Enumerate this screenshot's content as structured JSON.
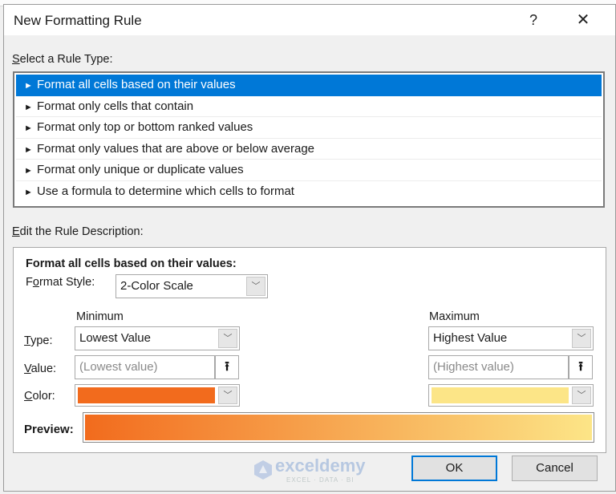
{
  "window": {
    "title": "New Formatting Rule",
    "help_label": "?",
    "close_label": "✕"
  },
  "rule_type": {
    "label_underline": "S",
    "label_rest": "elect a Rule Type:",
    "arrow_glyph": "►",
    "items": [
      {
        "label": "Format all cells based on their values",
        "selected": true
      },
      {
        "label": "Format only cells that contain",
        "selected": false
      },
      {
        "label": "Format only top or bottom ranked values",
        "selected": false
      },
      {
        "label": "Format only values that are above or below average",
        "selected": false
      },
      {
        "label": "Format only unique or duplicate values",
        "selected": false
      },
      {
        "label": "Use a formula to determine which cells to format",
        "selected": false
      }
    ]
  },
  "description": {
    "label_underline": "E",
    "label_rest": "dit the Rule Description:",
    "heading": "Format all cells based on their values:",
    "format_style": {
      "label_pre": "F",
      "label_underline": "o",
      "label_rest": "rmat Style:",
      "value": "2-Color Scale"
    },
    "minimum": {
      "header": "Minimum",
      "type": "Lowest Value",
      "value_placeholder": "(Lowest value)",
      "color": "#f26b1d"
    },
    "maximum": {
      "header": "Maximum",
      "type": "Highest Value",
      "value_placeholder": "(Highest value)",
      "color": "#fce587"
    },
    "labels": {
      "type_underline": "T",
      "type_rest": "ype:",
      "value_underline": "V",
      "value_rest": "alue:",
      "color_underline": "C",
      "color_rest": "olor:"
    },
    "preview_label": "Preview:",
    "dropdown_glyph": "﹀",
    "ref_glyph": "⭱"
  },
  "buttons": {
    "ok": "OK",
    "cancel": "Cancel"
  },
  "watermark": {
    "name": "exceldemy",
    "tagline": "EXCEL · DATA · BI"
  },
  "colors": {
    "accent": "#0078d7"
  }
}
